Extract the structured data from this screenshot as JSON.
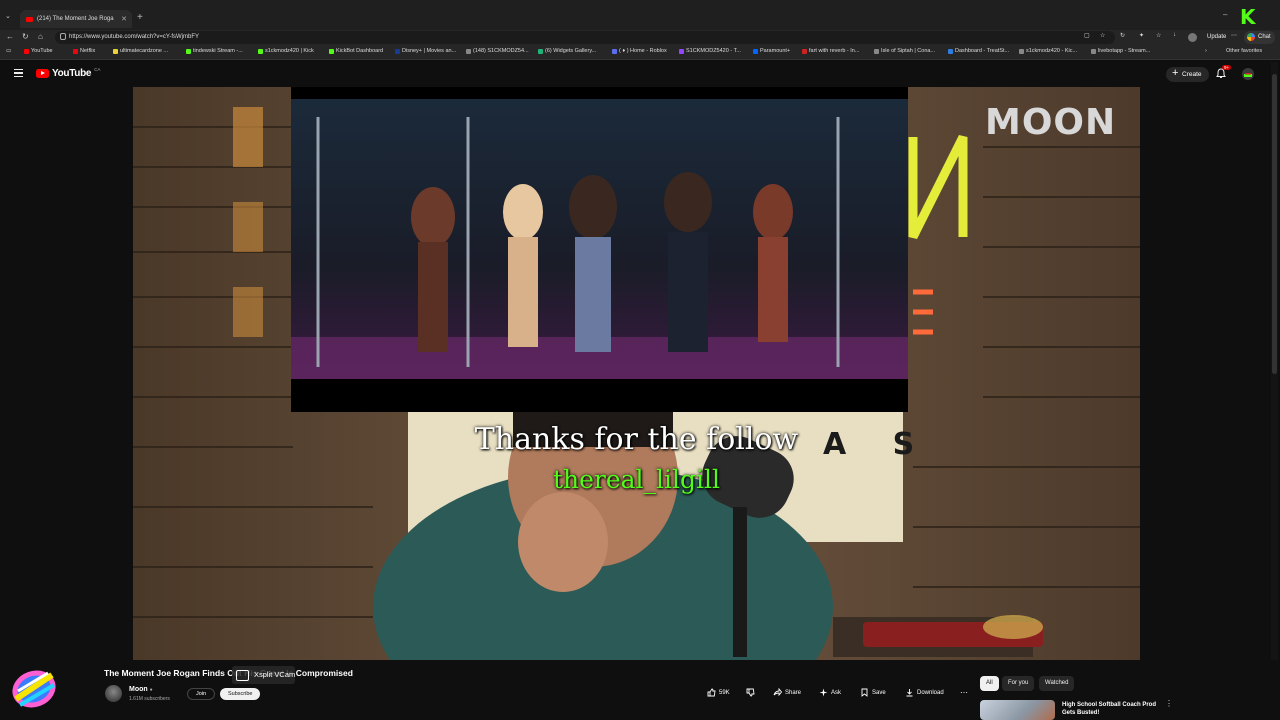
{
  "browser": {
    "tab_title": "(214) The Moment Joe Roga",
    "url": "https://www.youtube.com/watch?v=cY-fsWjmbFY",
    "update_label": "Update",
    "chat_label": "Chat",
    "other_favorites": "Other favorites",
    "bookmarks": [
      {
        "label": "YouTube",
        "color": "#ff0000"
      },
      {
        "label": "Netflix",
        "color": "#e50914"
      },
      {
        "label": "ultimatecardzone ...",
        "color": "#e8d33a"
      },
      {
        "label": "tindewski Stream -...",
        "color": "#53fc18"
      },
      {
        "label": "s1ckmodz420 | Kick",
        "color": "#53fc18"
      },
      {
        "label": "KickBot Dashboard",
        "color": "#53fc18"
      },
      {
        "label": "Disney+ | Movies an...",
        "color": "#1a3c8f"
      },
      {
        "label": "(148) S1CKMODZ54...",
        "color": "#888888"
      },
      {
        "label": "(6) Widgets Gallery...",
        "color": "#1fb37a"
      },
      {
        "label": "( ♦ ) Home - Roblox",
        "color": "#5a6cf0"
      },
      {
        "label": "S1CKMODZ5420 - T...",
        "color": "#9146ff"
      },
      {
        "label": "Paramount+",
        "color": "#0064ff"
      },
      {
        "label": "fart with reverb - In...",
        "color": "#cc2222"
      },
      {
        "label": "Isle of Siptah | Cona...",
        "color": "#888888"
      },
      {
        "label": "Dashboard - TreatSt...",
        "color": "#2f7de1"
      },
      {
        "label": "s1ckmodz420 - Kic...",
        "color": "#888888"
      },
      {
        "label": "livebotapp - Stream...",
        "color": "#888888"
      }
    ]
  },
  "youtube": {
    "logo_text": "YouTube",
    "country_code": "CA",
    "create_label": "Create",
    "notif_badge": "9+"
  },
  "video": {
    "subtitle_line1": "Thanks for the follow",
    "subtitle_line2": "thereal_lilgill",
    "sign_text": "MOON",
    "sign_letters": "A S"
  },
  "details": {
    "title": "The Moment Joe Rogan Finds Out His Guest Is Compromised",
    "overlay_label": "Xsplit VCam",
    "channel_name": "Moon",
    "subscribers": "1.61M subscribers",
    "join_label": "Join",
    "subscribe_label": "Subscribe",
    "likes": "59K",
    "share_label": "Share",
    "ask_label": "Ask",
    "save_label": "Save",
    "download_label": "Download"
  },
  "sidebar": {
    "chips": [
      "All",
      "For you",
      "Watched"
    ],
    "rec_title": "High School Softball Coach Prod Gets Busted!"
  },
  "colors": {
    "brand_red": "#ff0000",
    "kick_green": "#53fc18",
    "background": "#0f0f0f"
  }
}
